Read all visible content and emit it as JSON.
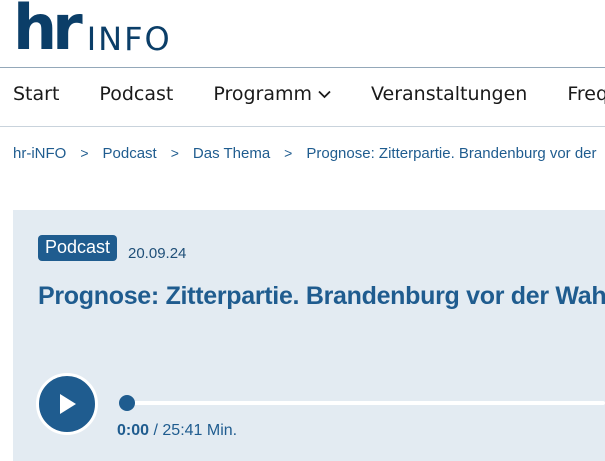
{
  "logo": {
    "primary": "hr",
    "secondary": "INFO"
  },
  "nav": {
    "items": [
      {
        "label": "Start"
      },
      {
        "label": "Podcast"
      },
      {
        "label": "Programm"
      },
      {
        "label": "Veranstaltungen"
      },
      {
        "label": "Freque"
      }
    ]
  },
  "breadcrumb": {
    "separator": ">",
    "items": [
      "hr-iNFO",
      "Podcast",
      "Das Thema",
      "Prognose: Zitterpartie. Brandenburg vor der"
    ]
  },
  "episode": {
    "badge": "Podcast",
    "date": "20.09.24",
    "title": "Prognose: Zitterpartie. Brandenburg vor der Wahl"
  },
  "player": {
    "current_time": "0:00",
    "separator": "/",
    "duration": "25:41 Min.",
    "progress": 0
  },
  "colors": {
    "brand": "#0b3e68",
    "accent": "#1f5c8f",
    "panel_bg": "#e3ebf2"
  }
}
